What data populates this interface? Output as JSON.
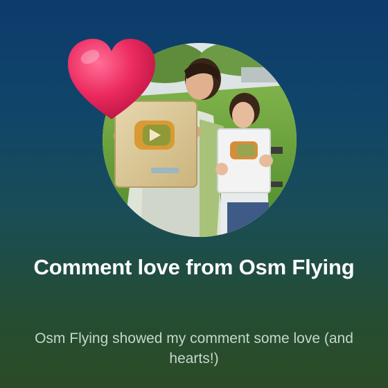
{
  "card": {
    "title": "Comment love from Osm Flying",
    "subtitle": "Osm Flying showed my comment some love (and hearts!)"
  },
  "icons": {
    "heart": "heart-icon",
    "avatar": "channel-avatar-photo"
  },
  "colors": {
    "background_top": "#0d3b6c",
    "background_bottom": "#2c4b25",
    "title": "#ffffff",
    "subtitle": "#c6d7cb",
    "heart": "#e8245a"
  }
}
